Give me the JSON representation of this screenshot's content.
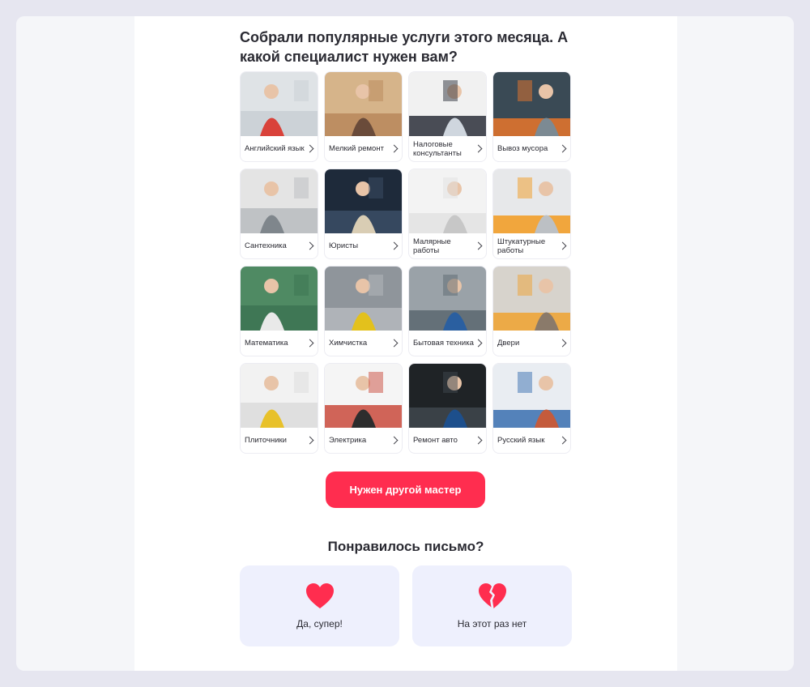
{
  "headline": "Собрали популярные услуги этого месяца. А какой специалист нужен вам?",
  "services": [
    {
      "label": "Английский язык",
      "icon": "classroom-photo",
      "colors": [
        "#dfe3e6",
        "#c9cfd4",
        "#d9423a"
      ]
    },
    {
      "label": "Мелкий ремонт",
      "icon": "woodwork-photo",
      "colors": [
        "#d6b48a",
        "#b8875a",
        "#6a4b3a"
      ]
    },
    {
      "label": "Налоговые консультанты",
      "icon": "office-meeting-photo",
      "colors": [
        "#f1f1f1",
        "#2b2f3a",
        "#cfd6de"
      ]
    },
    {
      "label": "Вывоз мусора",
      "icon": "workers-photo",
      "colors": [
        "#3a4a55",
        "#e9762b",
        "#7c8a93"
      ]
    },
    {
      "label": "Сантехника",
      "icon": "plumbing-photo",
      "colors": [
        "#e4e4e4",
        "#b9bcc0",
        "#7f868c"
      ]
    },
    {
      "label": "Юристы",
      "icon": "lawyer-photo",
      "colors": [
        "#1e2a3a",
        "#3b4d66",
        "#d9cdb4"
      ]
    },
    {
      "label": "Малярные работы",
      "icon": "painter-photo",
      "colors": [
        "#f3f3f3",
        "#e2e2e2",
        "#c7c7c7"
      ]
    },
    {
      "label": "Штукатурные работы",
      "icon": "plasterer-photo",
      "colors": [
        "#e7e8ea",
        "#f29a1f",
        "#bcc0c4"
      ]
    },
    {
      "label": "Математика",
      "icon": "blackboard-photo",
      "colors": [
        "#4f8a63",
        "#3c7352",
        "#e9e9e9"
      ]
    },
    {
      "label": "Химчистка",
      "icon": "carpet-cleaning-photo",
      "colors": [
        "#8f959b",
        "#b5b9bd",
        "#e3c11c"
      ]
    },
    {
      "label": "Бытовая техника",
      "icon": "appliance-repair-photo",
      "colors": [
        "#9aa2a8",
        "#5b6770",
        "#2a5fa0"
      ]
    },
    {
      "label": "Двери",
      "icon": "door-install-photo",
      "colors": [
        "#d7d3cc",
        "#f0a22f",
        "#8a7a6a"
      ]
    },
    {
      "label": "Плиточники",
      "icon": "tiling-photo",
      "colors": [
        "#f2f2f2",
        "#dcdcdc",
        "#e8c12a"
      ]
    },
    {
      "label": "Электрика",
      "icon": "electrician-photo",
      "colors": [
        "#f5f5f5",
        "#c94a3c",
        "#2d2d2d"
      ]
    },
    {
      "label": "Ремонт авто",
      "icon": "car-repair-photo",
      "colors": [
        "#1f2326",
        "#3f474d",
        "#1d4f8c"
      ]
    },
    {
      "label": "Русский язык",
      "icon": "tutoring-photo",
      "colors": [
        "#e9edf2",
        "#3a6fb0",
        "#c45b3c"
      ]
    }
  ],
  "cta_label": "Нужен другой мастер",
  "feedback": {
    "question": "Понравилось письмо?",
    "yes_label": "Да, супер!",
    "no_label": "На этот раз нет",
    "yes_icon": "heart-icon",
    "no_icon": "broken-heart-icon",
    "heart_color": "#ff2d4f"
  },
  "colors": {
    "accent": "#ff2d4f",
    "feedback_bg": "#eef0fd",
    "page_bg": "#e6e6f0"
  }
}
